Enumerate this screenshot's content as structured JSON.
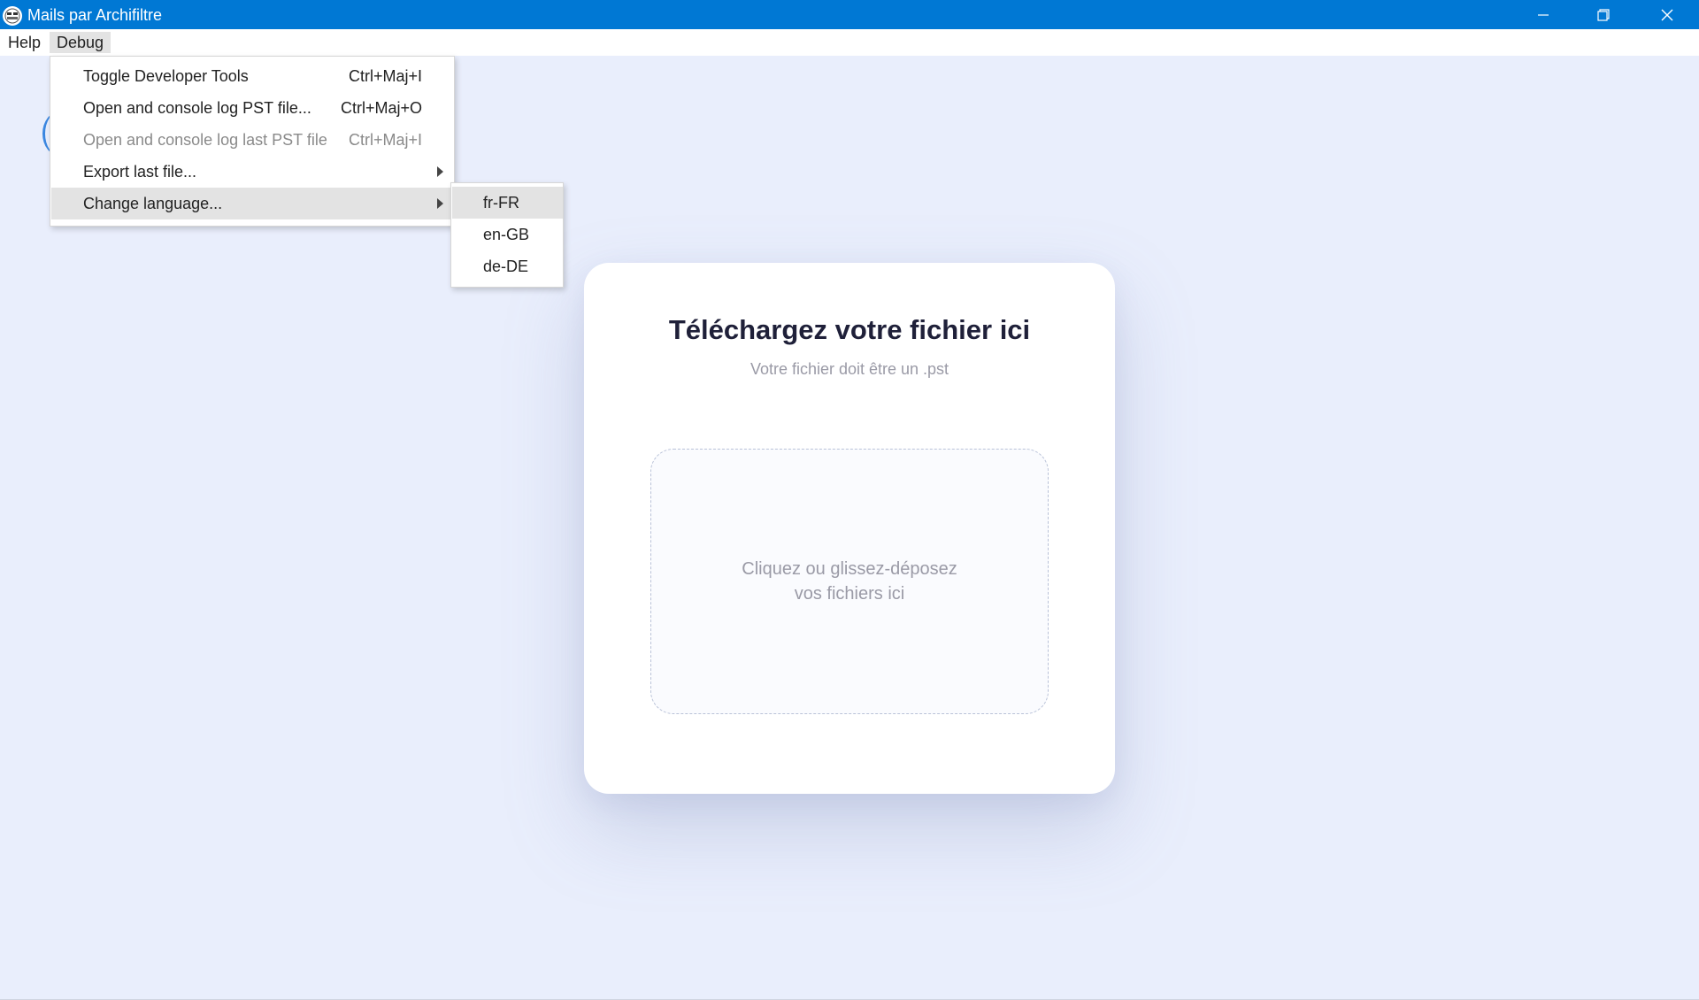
{
  "colors": {
    "accent": "#0078d4"
  },
  "window": {
    "title": "Mails par Archifiltre",
    "icon": "archifiltre-logo-icon",
    "controls": [
      "minimize-icon",
      "restore-icon",
      "close-icon"
    ]
  },
  "menubar": {
    "items": [
      {
        "label": "Help"
      },
      {
        "label": "Debug"
      }
    ]
  },
  "debug_menu": {
    "items": [
      {
        "label": "Toggle Developer Tools",
        "shortcut": "Ctrl+Maj+I"
      },
      {
        "label": "Open and console log PST file...",
        "shortcut": "Ctrl+Maj+O"
      },
      {
        "label": "Open and console log last PST file",
        "shortcut": "Ctrl+Maj+I",
        "disabled": true
      },
      {
        "label": "Export last file...",
        "submenu": true
      },
      {
        "label": "Change language...",
        "submenu": true,
        "highlighted": true
      }
    ]
  },
  "language_submenu": {
    "items": [
      {
        "label": "fr-FR",
        "highlighted": true
      },
      {
        "label": "en-GB"
      },
      {
        "label": "de-DE"
      }
    ]
  },
  "upload_card": {
    "title": "Téléchargez votre fichier ici",
    "subtitle": "Votre fichier doit être un .pst",
    "dropzone_line1": "Cliquez ou glissez-déposez",
    "dropzone_line2": "vos fichiers ici"
  }
}
